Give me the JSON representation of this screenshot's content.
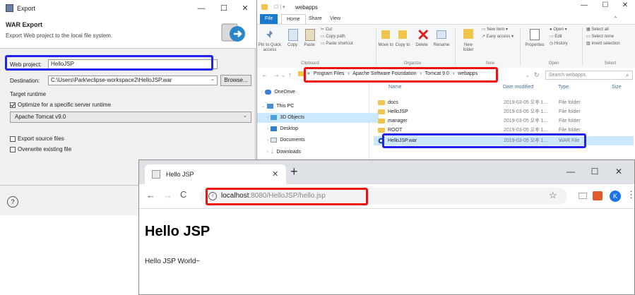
{
  "export_dialog": {
    "title": "Export",
    "header_title": "WAR Export",
    "header_desc": "Export Web project to the local file system.",
    "web_project_label": "Web project:",
    "web_project_value": "HelloJSP",
    "destination_label": "Destination:",
    "destination_value": "C:\\Users\\Park\\eclipse-workspace2\\HelloJSP.war",
    "browse_label": "Browse...",
    "target_runtime_label": "Target runtime",
    "optimize_label": "Optimize for a specific server runtime",
    "runtime_value": "Apache Tomcat v9.0",
    "export_source_label": "Export source files",
    "overwrite_label": "Overwrite existing file",
    "help_icon": "?"
  },
  "explorer": {
    "title": "webapps",
    "tabs": [
      "File",
      "Home",
      "Share",
      "View"
    ],
    "ribbon": {
      "pin_label": "Pin to Quick access",
      "copy_label": "Copy",
      "paste_label": "Paste",
      "cut_label": "Cut",
      "copy_path_label": "Copy path",
      "paste_shortcut_label": "Paste shortcut",
      "clipboard_group": "Clipboard",
      "move_to_label": "Move to",
      "copy_to_label": "Copy to",
      "delete_label": "Delete",
      "rename_label": "Rename",
      "organize_group": "Organize",
      "new_folder_label": "New folder",
      "new_item_label": "New item",
      "easy_access_label": "Easy access",
      "new_group": "New",
      "properties_label": "Properties",
      "open_label": "Open",
      "edit_label": "Edit",
      "history_label": "History",
      "open_group": "Open",
      "select_all_label": "Select all",
      "select_none_label": "Select none",
      "invert_selection_label": "Invert selection",
      "select_group": "Select"
    },
    "breadcrumb": [
      "Program Files",
      "Apache Software Foundation",
      "Tomcat 9.0",
      "webapps"
    ],
    "search_placeholder": "Search webapps",
    "nav": [
      "OneDrive",
      "This PC",
      "3D Objects",
      "Desktop",
      "Documents",
      "Downloads"
    ],
    "columns": [
      "Name",
      "Date modified",
      "Type",
      "Size"
    ],
    "files": [
      {
        "name": "docs",
        "date": "2019-03-05 오후 1...",
        "type": "File folder"
      },
      {
        "name": "HelloJSP",
        "date": "2019-03-05 오후 1...",
        "type": "File folder"
      },
      {
        "name": "manager",
        "date": "2019-03-05 오후 1...",
        "type": "File folder"
      },
      {
        "name": "ROOT",
        "date": "2019-03-05 오후 1...",
        "type": "File folder"
      },
      {
        "name": "HelloJSP.war",
        "date": "2019-03-05 오후 1...",
        "type": "WAR File"
      }
    ]
  },
  "browser": {
    "tab_title": "Hello JSP",
    "new_tab": "+",
    "url_host": "localhost",
    "url_rest": ":8080/HelloJSP/hello.jsp",
    "avatar": "K",
    "page_heading": "Hello JSP",
    "page_text": "Hello JSP World~"
  }
}
